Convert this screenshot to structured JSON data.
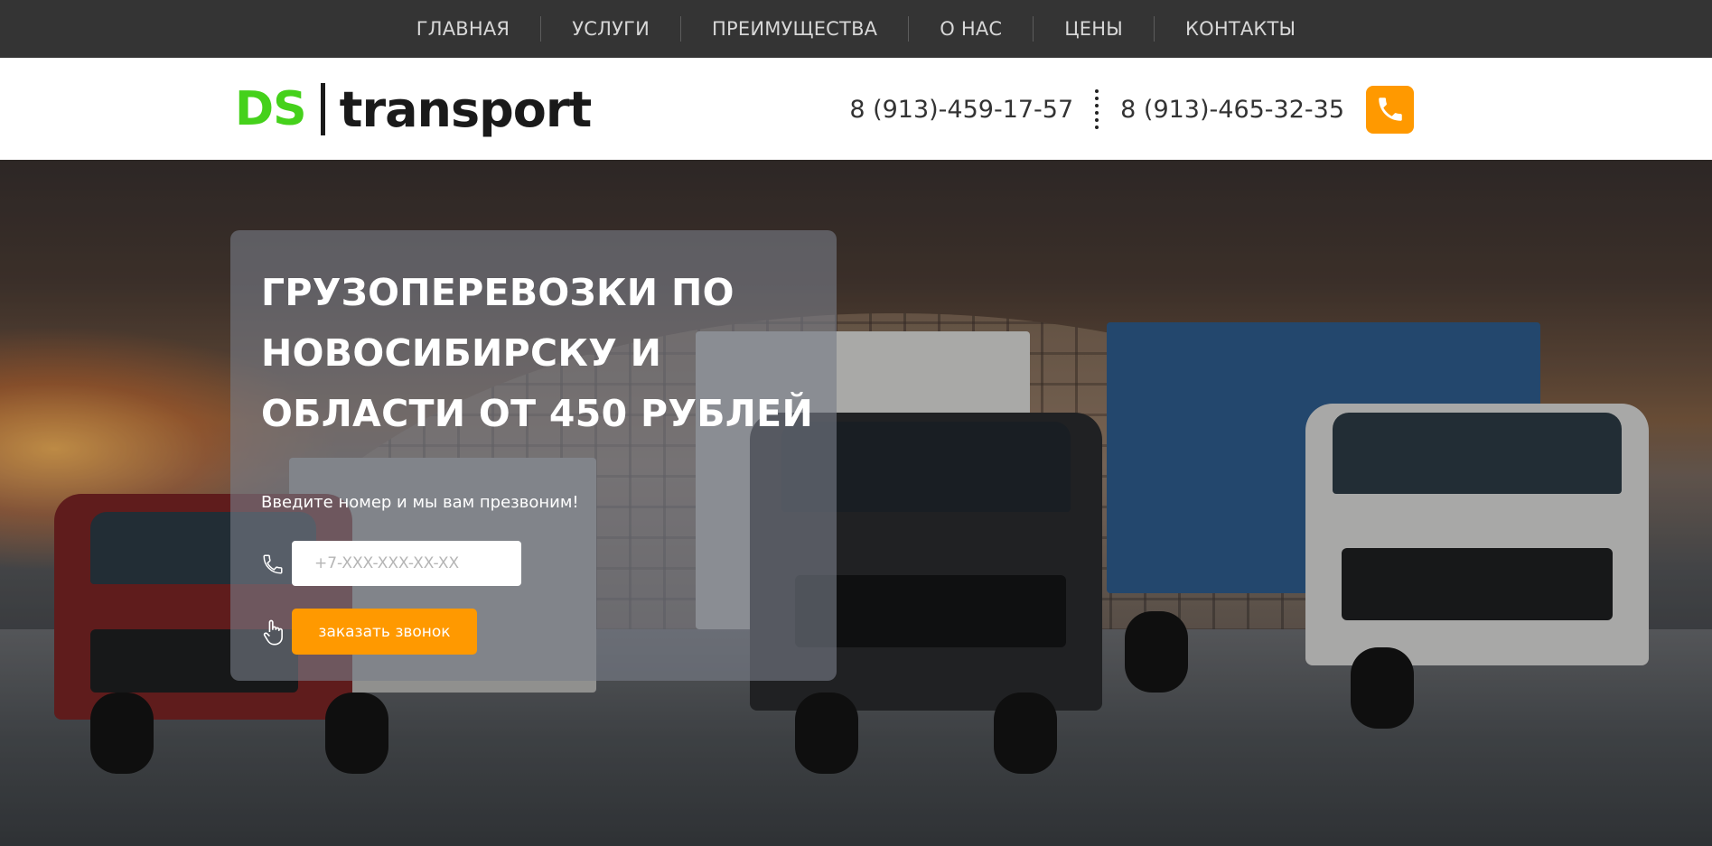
{
  "nav": {
    "items": [
      {
        "label": "ГЛАВНАЯ"
      },
      {
        "label": "УСЛУГИ"
      },
      {
        "label": "ПРЕИМУЩЕСТВА"
      },
      {
        "label": "О НАС"
      },
      {
        "label": "ЦЕНЫ"
      },
      {
        "label": "КОНТАКТЫ"
      }
    ]
  },
  "header": {
    "logo_ds": "DS",
    "logo_transport": "transport",
    "phone_1": "8 (913)-459-17-57",
    "phone_2": "8 (913)-465-32-35",
    "call_icon": "phone-icon",
    "accent_color": "#ff9900",
    "logo_color": "#45d11b"
  },
  "hero": {
    "title": "ГРУЗОПЕРЕВОЗКИ ПО НОВОСИБИРСКУ И ОБЛАСТИ ОТ 450 РУБЛЕЙ",
    "subtitle": "Введите номер и мы вам презвоним!",
    "phone_placeholder": "+7-XXX-XXX-XX-XX",
    "phone_value": "",
    "button_label": "заказать звонок",
    "input_icon": "phone-handset-icon",
    "button_icon": "hand-pointer-icon"
  }
}
